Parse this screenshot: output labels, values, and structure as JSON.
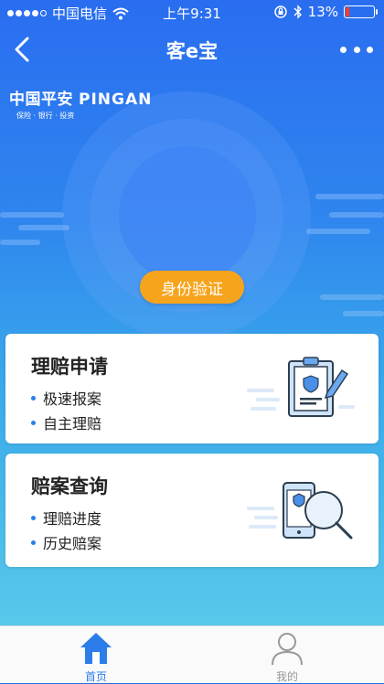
{
  "status_bar": {
    "carrier": "中国电信",
    "time": "上午9:31",
    "battery": "13%",
    "battery_level": 0.13,
    "icons": [
      "wifi-icon",
      "orientation-lock-icon",
      "bluetooth-icon",
      "battery-icon"
    ]
  },
  "nav": {
    "title": "客e宝",
    "back_icon": "chevron-left-icon",
    "more_icon": "more-icon"
  },
  "brand": {
    "name_cn": "中国平安",
    "name_en": "PINGAN",
    "tagline": "保险 · 银行 · 投资"
  },
  "hero": {
    "verify_button": "身份验证"
  },
  "cards": [
    {
      "title": "理赔申请",
      "items": [
        "极速报案",
        "自主理赔"
      ],
      "icon": "clipboard-pen-icon"
    },
    {
      "title": "赔案查询",
      "items": [
        "理赔进度",
        "历史赔案"
      ],
      "icon": "phone-magnifier-icon"
    }
  ],
  "tabs": [
    {
      "label": "首页",
      "icon": "home-icon",
      "active": true
    },
    {
      "label": "我的",
      "icon": "person-icon",
      "active": false
    }
  ],
  "colors": {
    "accent": "#2b7de9",
    "button": "#f7a41d",
    "tab_active": "#2b7de9",
    "tab_inactive": "#999999",
    "battery_low": "#ff3b30"
  }
}
